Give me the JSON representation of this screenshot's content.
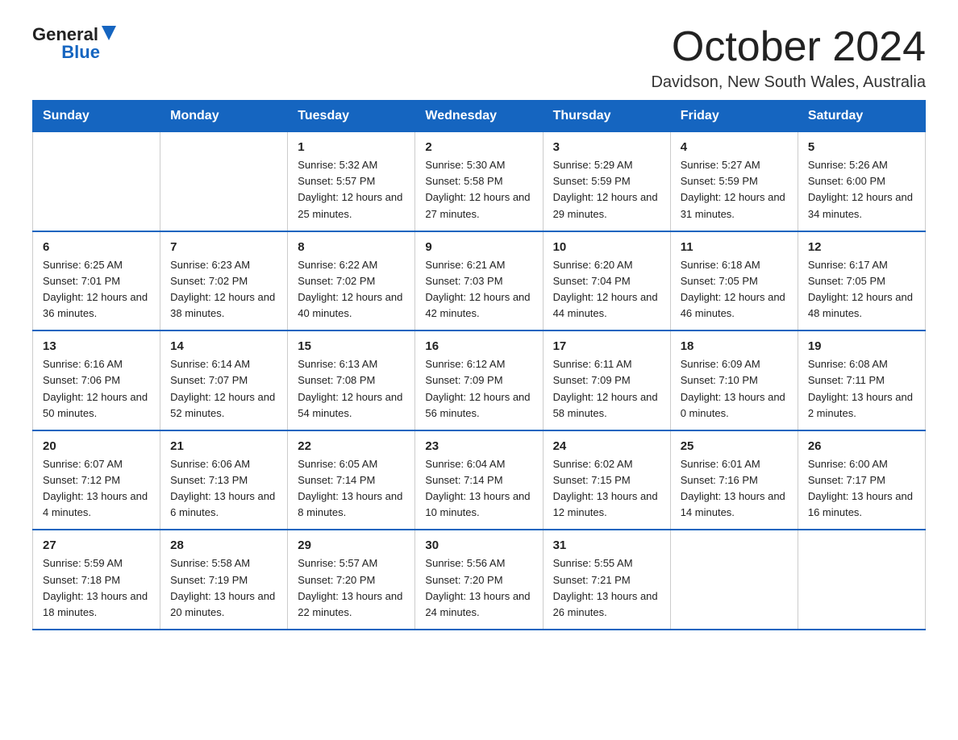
{
  "logo": {
    "text_general": "General",
    "text_blue": "Blue",
    "aria": "GeneralBlue logo"
  },
  "header": {
    "month_title": "October 2024",
    "location": "Davidson, New South Wales, Australia"
  },
  "days_of_week": [
    "Sunday",
    "Monday",
    "Tuesday",
    "Wednesday",
    "Thursday",
    "Friday",
    "Saturday"
  ],
  "weeks": [
    [
      {
        "day": "",
        "sunrise": "",
        "sunset": "",
        "daylight": ""
      },
      {
        "day": "",
        "sunrise": "",
        "sunset": "",
        "daylight": ""
      },
      {
        "day": "1",
        "sunrise": "Sunrise: 5:32 AM",
        "sunset": "Sunset: 5:57 PM",
        "daylight": "Daylight: 12 hours and 25 minutes."
      },
      {
        "day": "2",
        "sunrise": "Sunrise: 5:30 AM",
        "sunset": "Sunset: 5:58 PM",
        "daylight": "Daylight: 12 hours and 27 minutes."
      },
      {
        "day": "3",
        "sunrise": "Sunrise: 5:29 AM",
        "sunset": "Sunset: 5:59 PM",
        "daylight": "Daylight: 12 hours and 29 minutes."
      },
      {
        "day": "4",
        "sunrise": "Sunrise: 5:27 AM",
        "sunset": "Sunset: 5:59 PM",
        "daylight": "Daylight: 12 hours and 31 minutes."
      },
      {
        "day": "5",
        "sunrise": "Sunrise: 5:26 AM",
        "sunset": "Sunset: 6:00 PM",
        "daylight": "Daylight: 12 hours and 34 minutes."
      }
    ],
    [
      {
        "day": "6",
        "sunrise": "Sunrise: 6:25 AM",
        "sunset": "Sunset: 7:01 PM",
        "daylight": "Daylight: 12 hours and 36 minutes."
      },
      {
        "day": "7",
        "sunrise": "Sunrise: 6:23 AM",
        "sunset": "Sunset: 7:02 PM",
        "daylight": "Daylight: 12 hours and 38 minutes."
      },
      {
        "day": "8",
        "sunrise": "Sunrise: 6:22 AM",
        "sunset": "Sunset: 7:02 PM",
        "daylight": "Daylight: 12 hours and 40 minutes."
      },
      {
        "day": "9",
        "sunrise": "Sunrise: 6:21 AM",
        "sunset": "Sunset: 7:03 PM",
        "daylight": "Daylight: 12 hours and 42 minutes."
      },
      {
        "day": "10",
        "sunrise": "Sunrise: 6:20 AM",
        "sunset": "Sunset: 7:04 PM",
        "daylight": "Daylight: 12 hours and 44 minutes."
      },
      {
        "day": "11",
        "sunrise": "Sunrise: 6:18 AM",
        "sunset": "Sunset: 7:05 PM",
        "daylight": "Daylight: 12 hours and 46 minutes."
      },
      {
        "day": "12",
        "sunrise": "Sunrise: 6:17 AM",
        "sunset": "Sunset: 7:05 PM",
        "daylight": "Daylight: 12 hours and 48 minutes."
      }
    ],
    [
      {
        "day": "13",
        "sunrise": "Sunrise: 6:16 AM",
        "sunset": "Sunset: 7:06 PM",
        "daylight": "Daylight: 12 hours and 50 minutes."
      },
      {
        "day": "14",
        "sunrise": "Sunrise: 6:14 AM",
        "sunset": "Sunset: 7:07 PM",
        "daylight": "Daylight: 12 hours and 52 minutes."
      },
      {
        "day": "15",
        "sunrise": "Sunrise: 6:13 AM",
        "sunset": "Sunset: 7:08 PM",
        "daylight": "Daylight: 12 hours and 54 minutes."
      },
      {
        "day": "16",
        "sunrise": "Sunrise: 6:12 AM",
        "sunset": "Sunset: 7:09 PM",
        "daylight": "Daylight: 12 hours and 56 minutes."
      },
      {
        "day": "17",
        "sunrise": "Sunrise: 6:11 AM",
        "sunset": "Sunset: 7:09 PM",
        "daylight": "Daylight: 12 hours and 58 minutes."
      },
      {
        "day": "18",
        "sunrise": "Sunrise: 6:09 AM",
        "sunset": "Sunset: 7:10 PM",
        "daylight": "Daylight: 13 hours and 0 minutes."
      },
      {
        "day": "19",
        "sunrise": "Sunrise: 6:08 AM",
        "sunset": "Sunset: 7:11 PM",
        "daylight": "Daylight: 13 hours and 2 minutes."
      }
    ],
    [
      {
        "day": "20",
        "sunrise": "Sunrise: 6:07 AM",
        "sunset": "Sunset: 7:12 PM",
        "daylight": "Daylight: 13 hours and 4 minutes."
      },
      {
        "day": "21",
        "sunrise": "Sunrise: 6:06 AM",
        "sunset": "Sunset: 7:13 PM",
        "daylight": "Daylight: 13 hours and 6 minutes."
      },
      {
        "day": "22",
        "sunrise": "Sunrise: 6:05 AM",
        "sunset": "Sunset: 7:14 PM",
        "daylight": "Daylight: 13 hours and 8 minutes."
      },
      {
        "day": "23",
        "sunrise": "Sunrise: 6:04 AM",
        "sunset": "Sunset: 7:14 PM",
        "daylight": "Daylight: 13 hours and 10 minutes."
      },
      {
        "day": "24",
        "sunrise": "Sunrise: 6:02 AM",
        "sunset": "Sunset: 7:15 PM",
        "daylight": "Daylight: 13 hours and 12 minutes."
      },
      {
        "day": "25",
        "sunrise": "Sunrise: 6:01 AM",
        "sunset": "Sunset: 7:16 PM",
        "daylight": "Daylight: 13 hours and 14 minutes."
      },
      {
        "day": "26",
        "sunrise": "Sunrise: 6:00 AM",
        "sunset": "Sunset: 7:17 PM",
        "daylight": "Daylight: 13 hours and 16 minutes."
      }
    ],
    [
      {
        "day": "27",
        "sunrise": "Sunrise: 5:59 AM",
        "sunset": "Sunset: 7:18 PM",
        "daylight": "Daylight: 13 hours and 18 minutes."
      },
      {
        "day": "28",
        "sunrise": "Sunrise: 5:58 AM",
        "sunset": "Sunset: 7:19 PM",
        "daylight": "Daylight: 13 hours and 20 minutes."
      },
      {
        "day": "29",
        "sunrise": "Sunrise: 5:57 AM",
        "sunset": "Sunset: 7:20 PM",
        "daylight": "Daylight: 13 hours and 22 minutes."
      },
      {
        "day": "30",
        "sunrise": "Sunrise: 5:56 AM",
        "sunset": "Sunset: 7:20 PM",
        "daylight": "Daylight: 13 hours and 24 minutes."
      },
      {
        "day": "31",
        "sunrise": "Sunrise: 5:55 AM",
        "sunset": "Sunset: 7:21 PM",
        "daylight": "Daylight: 13 hours and 26 minutes."
      },
      {
        "day": "",
        "sunrise": "",
        "sunset": "",
        "daylight": ""
      },
      {
        "day": "",
        "sunrise": "",
        "sunset": "",
        "daylight": ""
      }
    ]
  ]
}
